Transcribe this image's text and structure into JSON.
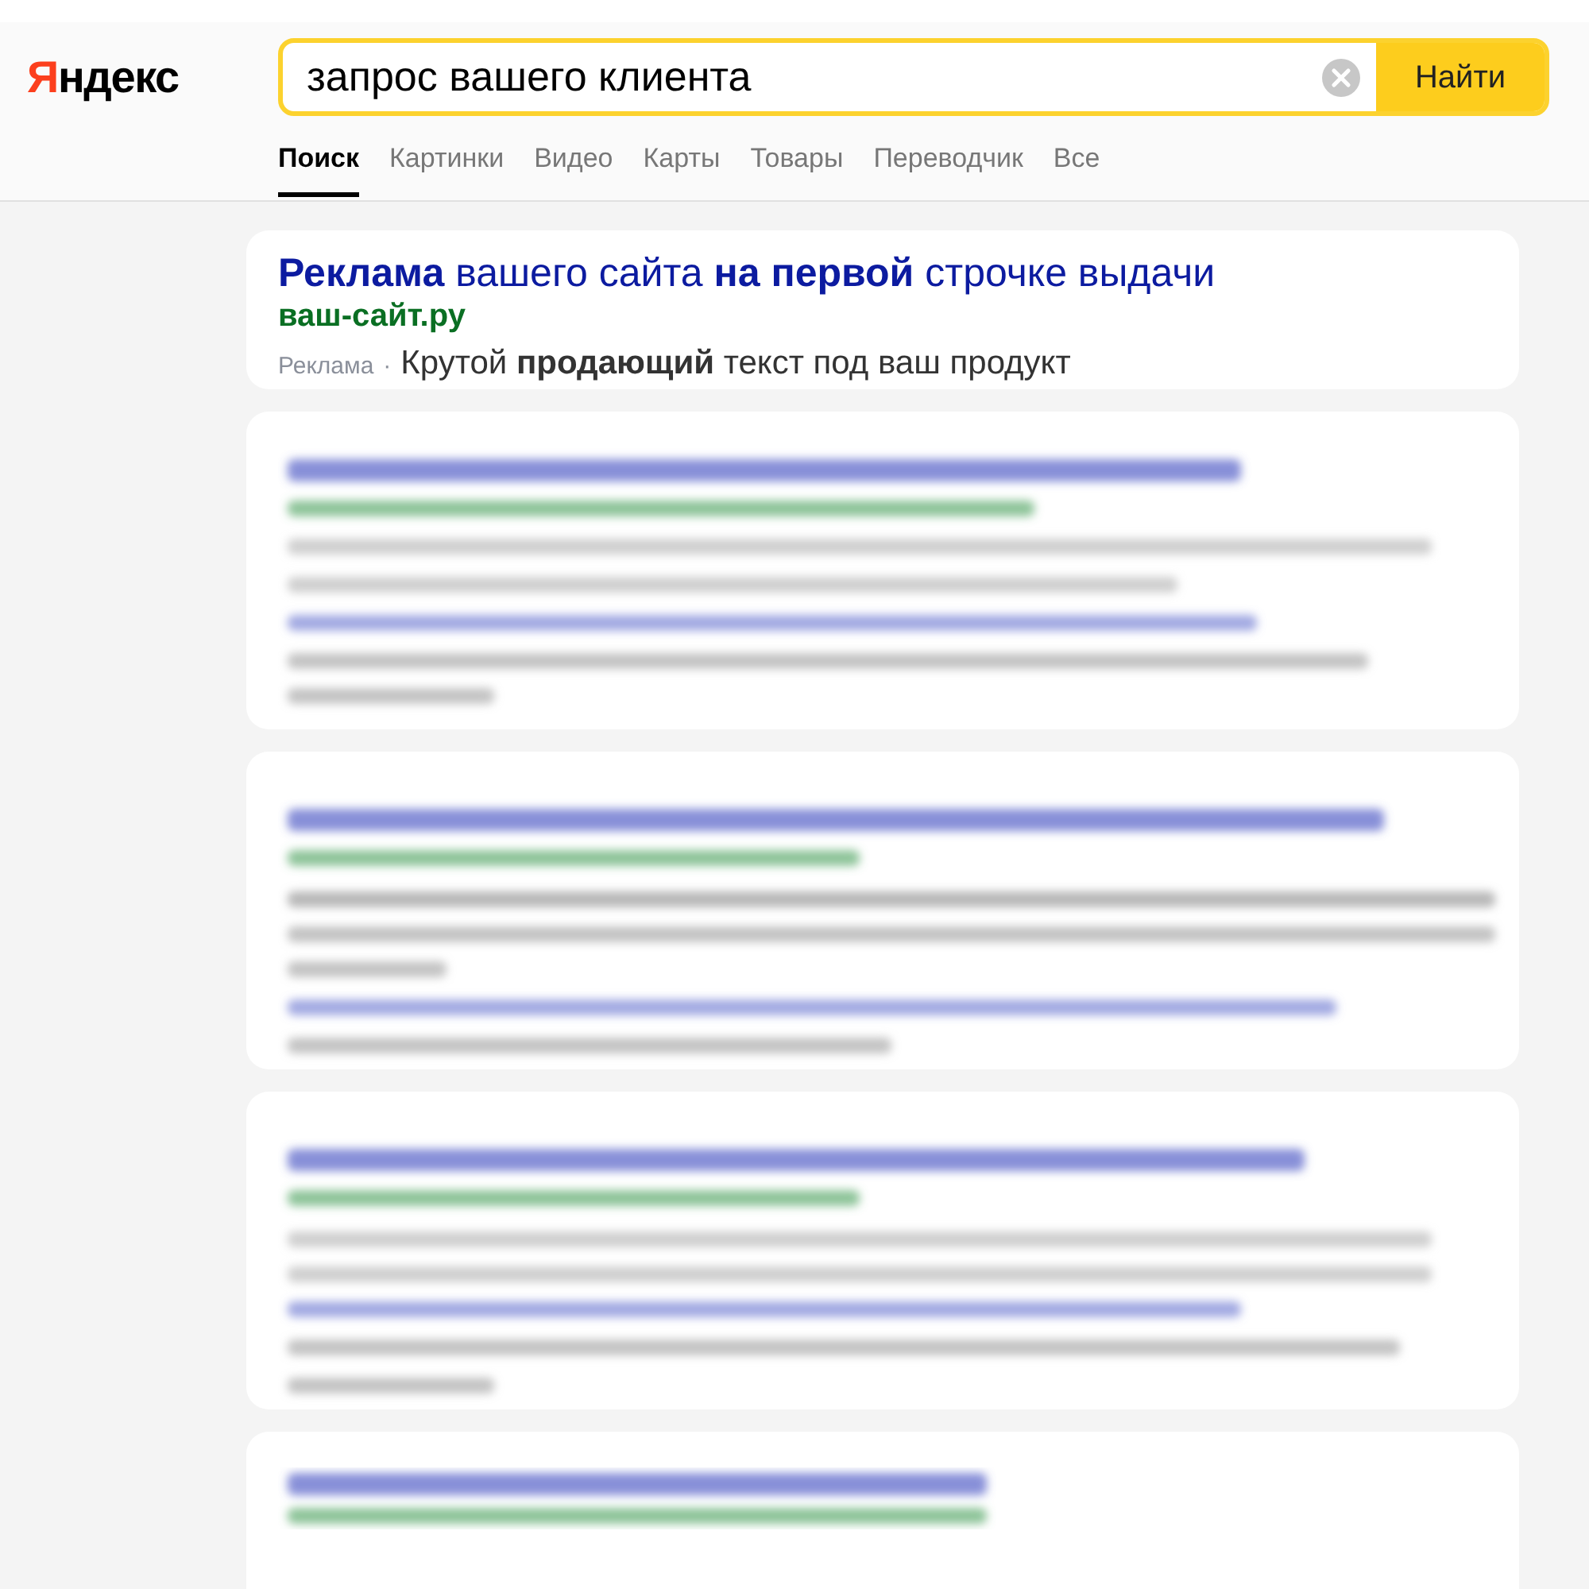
{
  "logo": "Яндекс",
  "search": {
    "value": "запрос вашего клиента",
    "button": "Найти"
  },
  "tabs": [
    {
      "label": "Поиск",
      "selected": true
    },
    {
      "label": "Картинки",
      "selected": false
    },
    {
      "label": "Видео",
      "selected": false
    },
    {
      "label": "Карты",
      "selected": false
    },
    {
      "label": "Товары",
      "selected": false
    },
    {
      "label": "Переводчик",
      "selected": false
    },
    {
      "label": "Все",
      "selected": false
    }
  ],
  "ad": {
    "title": "**Реклама** вашего сайта **на первой** строчке выдачи",
    "url": "ваш-сайт.ру",
    "label": "Реклама",
    "separator": "·",
    "text": "Крутой **продающий** текст под ваш продукт"
  },
  "blurred_results": [
    {
      "kind": "blurred"
    },
    {
      "kind": "blurred"
    },
    {
      "kind": "blurred"
    },
    {
      "kind": "blurred"
    }
  ]
}
